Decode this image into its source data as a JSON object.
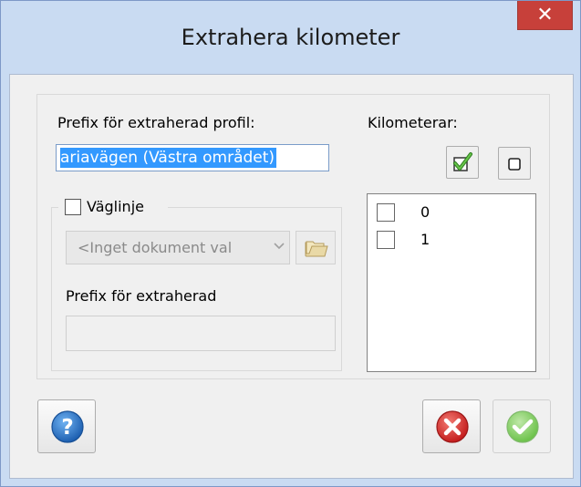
{
  "window": {
    "title": "Extrahera kilometer",
    "close_glyph": "✕"
  },
  "form": {
    "prefix_label": "Prefix för extraherad profil:",
    "prefix_value": "ariavägen (Västra området)",
    "vaglinje_label": "Väglinje",
    "vaglinje_checked": false,
    "document_select_value": "<Inget dokument val",
    "document_select_enabled": false,
    "prefix_extraherad_label": "Prefix för extraherad",
    "prefix_extraherad_value": ""
  },
  "kilometer": {
    "label": "Kilometerar:",
    "items": [
      {
        "label": "0",
        "checked": false
      },
      {
        "label": "1",
        "checked": false
      }
    ]
  },
  "buttons": {
    "help": "help-icon",
    "cancel": "cancel-icon",
    "ok": "ok-icon",
    "ok_enabled": false
  },
  "colors": {
    "selection": "#3399ff",
    "cancel_red": "#d93030",
    "ok_green": "#7ccf5a",
    "help_blue": "#2d7bd6"
  }
}
